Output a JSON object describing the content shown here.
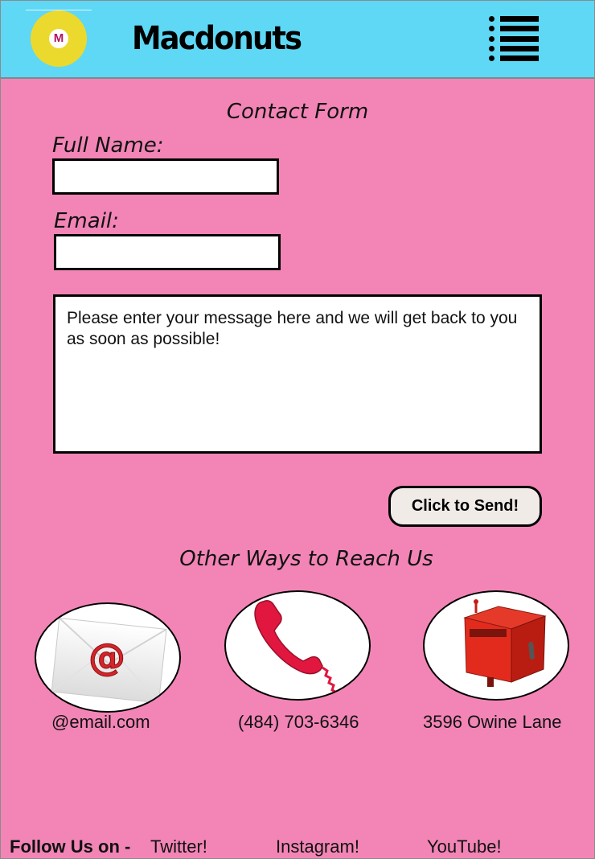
{
  "header": {
    "brand": "Macdonuts",
    "logo_letter": "M",
    "logo_icon": "macdonuts-logo-icon",
    "menu_icon": "hamburger-menu-icon"
  },
  "form": {
    "title": "Contact Form",
    "full_name_label": "Full Name:",
    "full_name_value": "",
    "email_label": "Email:",
    "email_value": "",
    "message_placeholder": "Please enter your message here and we will get back to you as soon as possible!",
    "send_label": "Click to Send!"
  },
  "other_ways": {
    "title": "Other Ways to Reach Us",
    "items": [
      {
        "icon": "email-envelope-icon",
        "label": "@email.com"
      },
      {
        "icon": "phone-icon",
        "label": "(484) 703-6346"
      },
      {
        "icon": "mailbox-icon",
        "label": "3596 Owine Lane"
      }
    ]
  },
  "footer": {
    "follow_label": "Follow Us on -",
    "links": [
      "Twitter!",
      "Instagram!",
      "YouTube!"
    ]
  },
  "colors": {
    "background": "#f285b6",
    "header": "#5ed8f5",
    "logo": "#ecd92e",
    "logo_letter": "#b0155c",
    "button": "#f1ebe8",
    "icon_red": "#e2173f"
  }
}
